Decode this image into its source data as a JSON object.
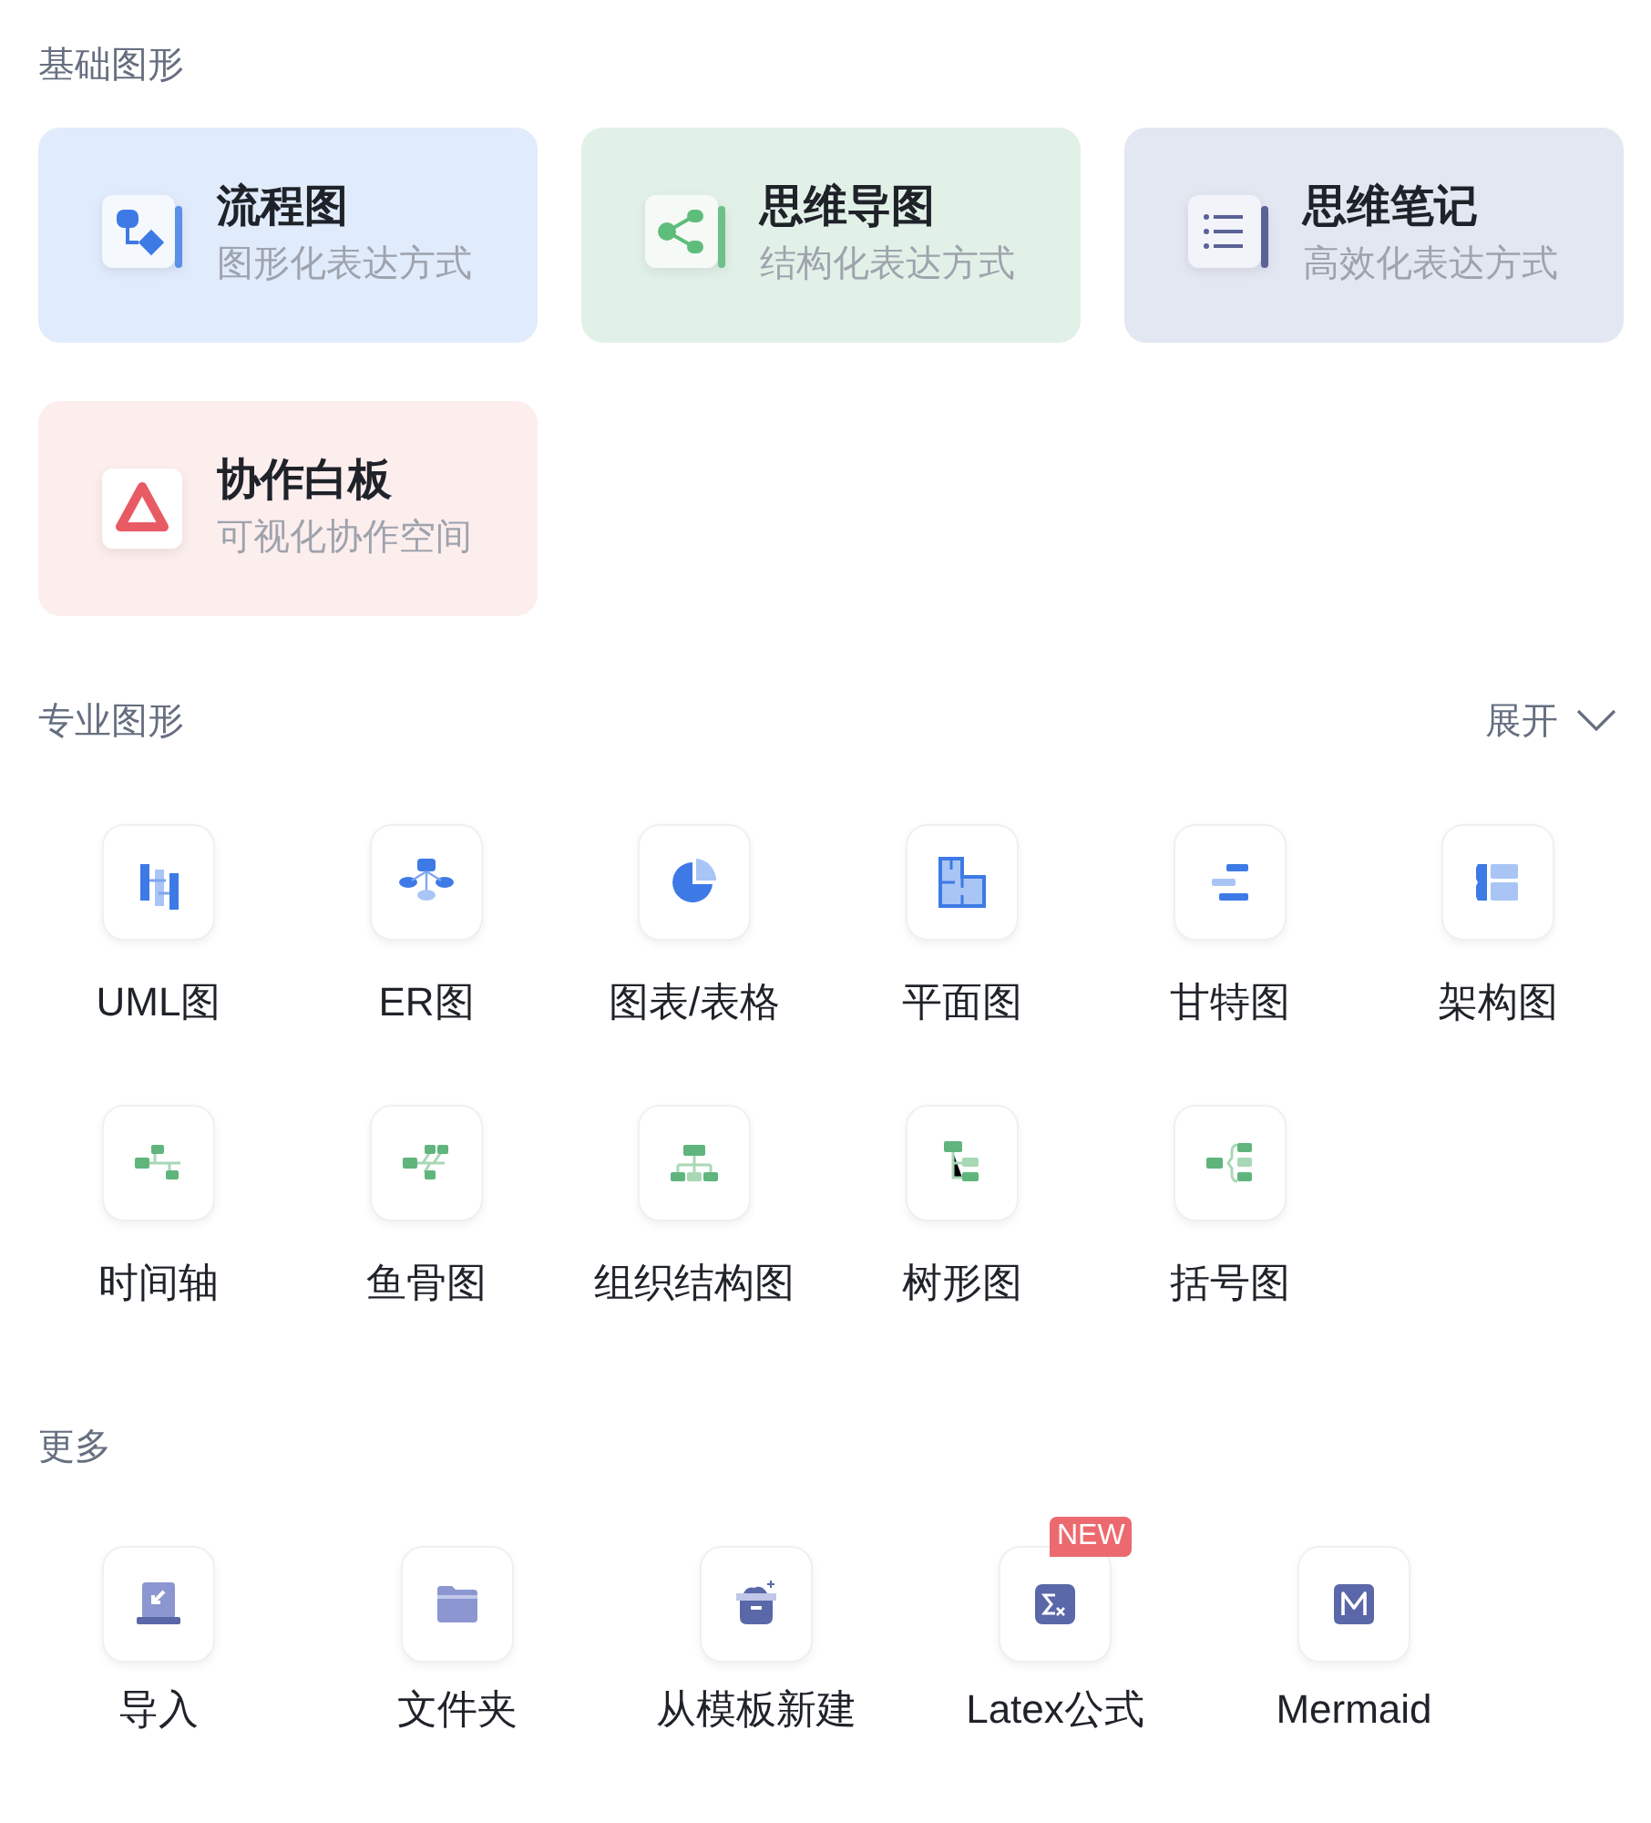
{
  "basic_section": {
    "title": "基础图形"
  },
  "basic_cards": [
    {
      "title": "流程图",
      "subtitle": "图形化表达方式",
      "color": "#e0ebfb",
      "kind": "flowchart"
    },
    {
      "title": "思维导图",
      "subtitle": "结构化表达方式",
      "color": "#e2f1e8",
      "kind": "mindmap"
    },
    {
      "title": "思维笔记",
      "subtitle": "高效化表达方式",
      "color": "#e3e7f2",
      "kind": "notes"
    },
    {
      "title": "协作白板",
      "subtitle": "可视化协作空间",
      "color": "#fdeeee",
      "kind": "whiteboard"
    }
  ],
  "pro_section": {
    "title": "专业图形",
    "expand": "展开"
  },
  "pro_items": [
    {
      "label": "UML图",
      "kind": "uml"
    },
    {
      "label": "ER图",
      "kind": "er"
    },
    {
      "label": "图表/表格",
      "kind": "pie"
    },
    {
      "label": "平面图",
      "kind": "floorplan"
    },
    {
      "label": "甘特图",
      "kind": "gantt"
    },
    {
      "label": "架构图",
      "kind": "architecture"
    },
    {
      "label": "时间轴",
      "kind": "timeline"
    },
    {
      "label": "鱼骨图",
      "kind": "fishbone"
    },
    {
      "label": "组织结构图",
      "kind": "org"
    },
    {
      "label": "树形图",
      "kind": "tree"
    },
    {
      "label": "括号图",
      "kind": "bracket"
    }
  ],
  "more_section": {
    "title": "更多"
  },
  "more_items": [
    {
      "label": "导入",
      "kind": "import"
    },
    {
      "label": "文件夹",
      "kind": "folder"
    },
    {
      "label": "从模板新建",
      "kind": "template"
    },
    {
      "label": "Latex公式",
      "kind": "latex",
      "badge": "NEW"
    },
    {
      "label": "Mermaid",
      "kind": "mermaid"
    }
  ]
}
